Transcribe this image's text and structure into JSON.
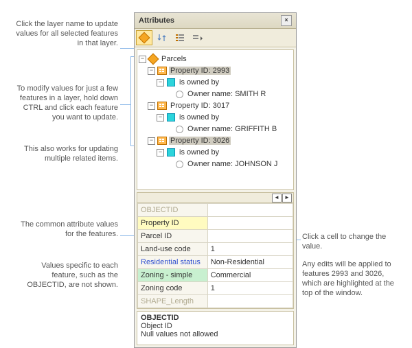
{
  "window": {
    "title": "Attributes"
  },
  "tree": {
    "root": "Parcels",
    "items": [
      {
        "label": "Property ID: 2993",
        "owner": "Owner name: SMITH R",
        "rel": "is owned by",
        "selected": true
      },
      {
        "label": "Property ID: 3017",
        "owner": "Owner name: GRIFFITH B",
        "rel": "is owned by",
        "selected": false
      },
      {
        "label": "Property ID: 3026",
        "owner": "Owner name: JOHNSON J",
        "rel": "is owned by",
        "selected": true
      }
    ]
  },
  "grid": {
    "rows": [
      {
        "name": "OBJECTID",
        "value": "",
        "dim": true
      },
      {
        "name": "Property ID",
        "value": "",
        "hl": "y"
      },
      {
        "name": "Parcel ID",
        "value": ""
      },
      {
        "name": "Land-use code",
        "value": "1"
      },
      {
        "name": "Residential status",
        "value": "Non-Residential",
        "hl": "b"
      },
      {
        "name": "Zoning - simple",
        "value": "Commercial",
        "hl": "g"
      },
      {
        "name": "Zoning code",
        "value": "1"
      },
      {
        "name": "SHAPE_Length",
        "value": "",
        "dim": true
      }
    ]
  },
  "info": {
    "title": "OBJECTID",
    "line1": "Object ID",
    "line2": "Null values not allowed"
  },
  "callouts": {
    "c1": "Click the layer name to update values for all selected features in that layer.",
    "c2": "To modify values for just a few features in a layer, hold down CTRL and click each feature you want to update.",
    "c3": "This also works for updating multiple related items.",
    "c4": "The common attribute values for the features.",
    "c5": "Values specific to each feature, such as the OBJECTID, are not shown.",
    "c6": "Click a cell to change the value.",
    "c7": "Any edits will be applied to features 2993 and 3026, which are highlighted at the top of the window."
  }
}
